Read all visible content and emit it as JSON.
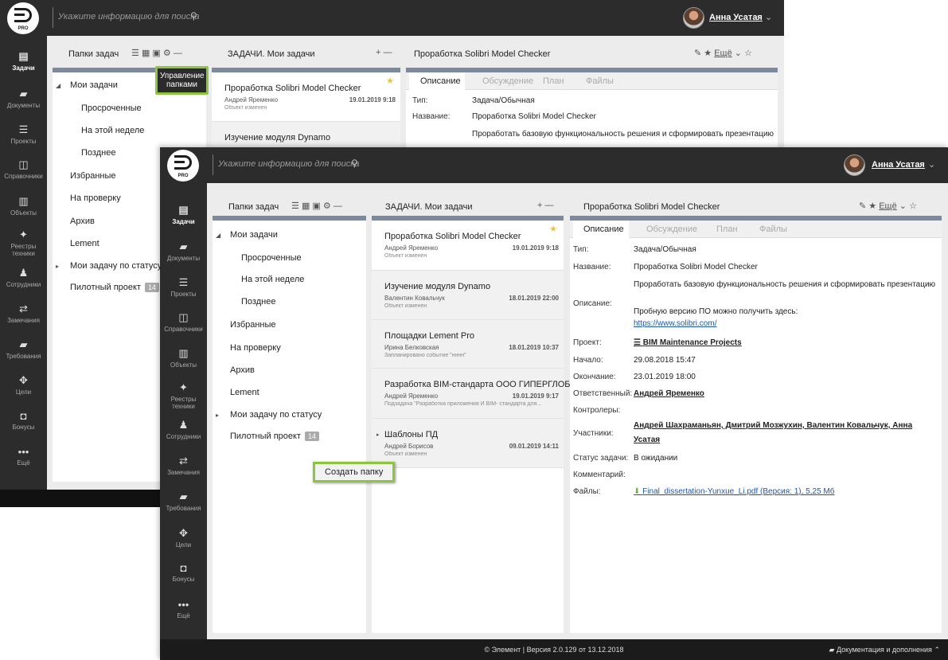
{
  "app": {
    "search_placeholder": "Укажите информацию для поиска",
    "user_name": "Анна Усатая",
    "logo_label": "PRO"
  },
  "sidebar": {
    "items": [
      {
        "label": "Задачи",
        "icon": "clipboard-icon",
        "glyph": "▤"
      },
      {
        "label": "Документы",
        "icon": "folder-icon",
        "glyph": "▰"
      },
      {
        "label": "Проекты",
        "icon": "layers-icon",
        "glyph": "☰"
      },
      {
        "label": "Справочники",
        "icon": "book-icon",
        "glyph": "◫"
      },
      {
        "label": "Объекты",
        "icon": "building-icon",
        "glyph": "▥"
      },
      {
        "label": "Реестры техники",
        "icon": "crane-icon",
        "glyph": "⛏"
      },
      {
        "label": "Сотрудники",
        "icon": "people-icon",
        "glyph": "♟"
      },
      {
        "label": "Замечания",
        "icon": "swap-icon",
        "glyph": "⇄"
      },
      {
        "label": "Требования",
        "icon": "note-icon",
        "glyph": "▰"
      },
      {
        "label": "Цели",
        "icon": "target-icon",
        "glyph": "✥"
      },
      {
        "label": "Бонусы",
        "icon": "bonus-icon",
        "glyph": "◘"
      },
      {
        "label": "Ещё",
        "icon": "more-icon",
        "glyph": "• • •"
      }
    ]
  },
  "folders": {
    "header": "Папки задач",
    "root": "Мои задачи",
    "children": [
      "Просроченные",
      "На этой неделе",
      "Позднее"
    ],
    "others": [
      "Избранные",
      "На проверку",
      "Архив",
      "Lement"
    ],
    "by_status": "Мои задачу по статусу",
    "pilot": "Пилотный проект",
    "pilot_count": "14"
  },
  "tasks": {
    "header": "ЗАДАЧИ. Мои задачи",
    "items": [
      {
        "title": "Проработка Solibri Model Checker",
        "person": "Андрей Яременко",
        "date": "19.01.2019 9:18",
        "status": "Объект изменен"
      },
      {
        "title": "Изучение модуля Dynamo",
        "person": "Валентин Ковальчук",
        "date": "18.01.2019 22:00",
        "status": "Объект изменен"
      },
      {
        "title": "Площадки Lement Pro",
        "person": "Ирина Белковская",
        "date": "18.01.2019 10:37",
        "status": "Запланировано событие \"нннн\""
      },
      {
        "title": "Разработка BIM-стандарта ООО ГИПЕРГЛОБ.",
        "person": "Андрей Яременко",
        "date": "19.01.2019 9:17",
        "status": "Подзадача \"Разработка приложения И BIM- стандарта для..."
      },
      {
        "title": "Шаблоны ПД",
        "person": "Андрей Борисов",
        "date": "09.01.2019 14:11",
        "status": "Объект изменен"
      }
    ]
  },
  "details": {
    "header": "Проработка Solibri Model Checker",
    "more_label": "Ещё",
    "tabs": [
      "Описание",
      "Обсуждение",
      "План",
      "Файлы"
    ],
    "labels": {
      "type": "Тип:",
      "name": "Название:",
      "desc": "Описание:",
      "project": "Проект:",
      "start": "Начало:",
      "end": "Окончание:",
      "responsible": "Ответственный:",
      "controllers": "Контролеры:",
      "participants": "Участники:",
      "status": "Статус задачи:",
      "comment": "Комментарий:",
      "files": "Файлы:"
    },
    "type": "Задача/Обычная",
    "name": "Проработка Solibri Model Checker",
    "desc_line1": "Проработать базовую функциональность решения и сформировать презентацию",
    "desc_line2": "Пробную версию ПО можно получить здесь:",
    "desc_link": "https://www.solibri.com/",
    "project": "BIM Maintenance Projects",
    "start": "29.08.2018 15:47",
    "end": "23.01.2019 18:00",
    "responsible": "Андрей Яременко",
    "participants_line1": "Андрей Шахраманьян, Дмитрий Мозжухин, Валентин Ковальчук, Анна",
    "participants_line2": "Усатая",
    "status": "В ожидании",
    "file": "Final_dissertation-Yunxue_Li.pdf (Версия: 1), 5,25 Мб"
  },
  "footer": {
    "copyright": "© Элемент | Версия 2.0.129 от 13.12.2018",
    "docs": "Документация и дополнения"
  },
  "tooltip": {
    "text_line1": "Управление",
    "text_line2": "папками"
  },
  "context_menu": {
    "create_folder": "Создать папку"
  },
  "colors": {
    "accent_green": "#8cc63f",
    "panel_bar": "#7d8a9e",
    "dark_bar": "#2c2c2c",
    "star": "#e8c24b",
    "link": "#1c56b5"
  }
}
